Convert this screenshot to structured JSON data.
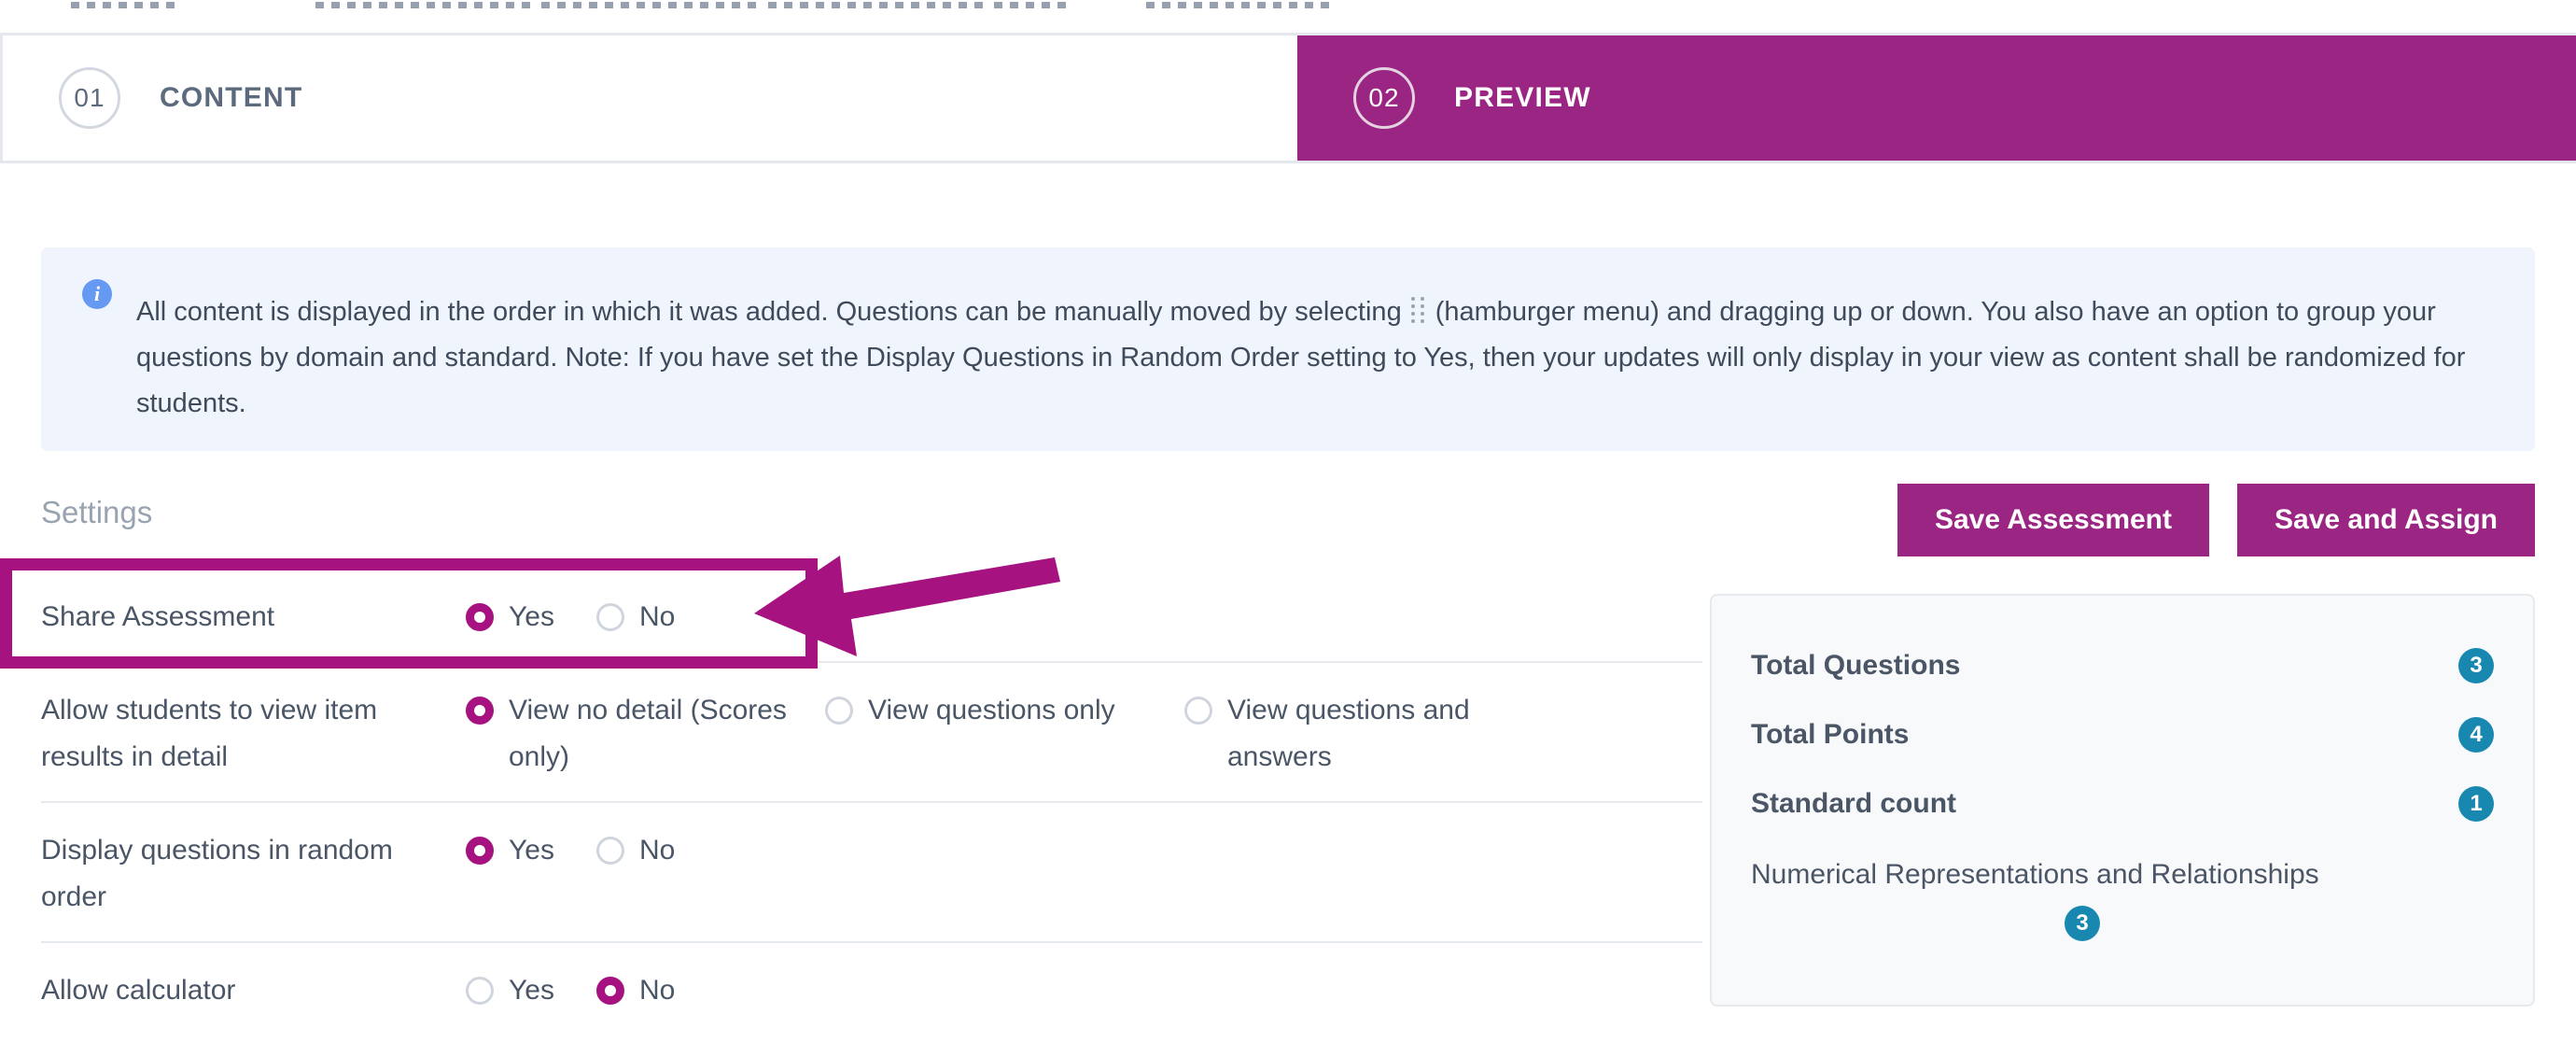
{
  "tabs": [
    {
      "number": "01",
      "label": "CONTENT",
      "active": false
    },
    {
      "number": "02",
      "label": "PREVIEW",
      "active": true
    }
  ],
  "banner": {
    "icon": "info-icon",
    "text_part1": "All content is displayed in the order in which it was added. Questions can be manually moved by selecting",
    "drag_icon": "drag-handle-icon",
    "text_part2": "(hamburger menu) and dragging up or down. You also have an option to group your questions by domain and standard. Note: If you have set the Display Questions in Random Order setting to Yes, then your updates will only display in your view as content shall be randomized for students."
  },
  "settings": {
    "title": "Settings",
    "save_assessment_label": "Save Assessment",
    "save_and_assign_label": "Save and Assign",
    "rows": [
      {
        "label": "Share Assessment",
        "highlighted": true,
        "options": [
          {
            "label": "Yes",
            "selected": true
          },
          {
            "label": "No",
            "selected": false
          }
        ]
      },
      {
        "label": "Allow students to view item results in detail",
        "highlighted": false,
        "options": [
          {
            "label": "View no detail (Scores only)",
            "selected": true
          },
          {
            "label": "View questions only",
            "selected": false
          },
          {
            "label": "View questions and answers",
            "selected": false
          }
        ]
      },
      {
        "label": "Display questions in random order",
        "highlighted": false,
        "options": [
          {
            "label": "Yes",
            "selected": true
          },
          {
            "label": "No",
            "selected": false
          }
        ]
      },
      {
        "label": "Allow calculator",
        "highlighted": false,
        "options": [
          {
            "label": "Yes",
            "selected": false
          },
          {
            "label": "No",
            "selected": true
          }
        ]
      }
    ]
  },
  "summary": {
    "rows": [
      {
        "label": "Total Questions",
        "value": "3"
      },
      {
        "label": "Total Points",
        "value": "4"
      },
      {
        "label": "Standard count",
        "value": "1"
      }
    ],
    "standard_name": "Numerical Representations and Relationships",
    "standard_value": "3"
  },
  "annotation": {
    "arrow": "left-pointing-arrow",
    "highlight": "highlight-rectangle"
  },
  "colors": {
    "brand_purple": "#9b2583",
    "annotation_purple": "#a6127f",
    "badge_blue": "#1888b0",
    "info_blue": "#6699f2",
    "banner_bg": "#eff4fd"
  }
}
